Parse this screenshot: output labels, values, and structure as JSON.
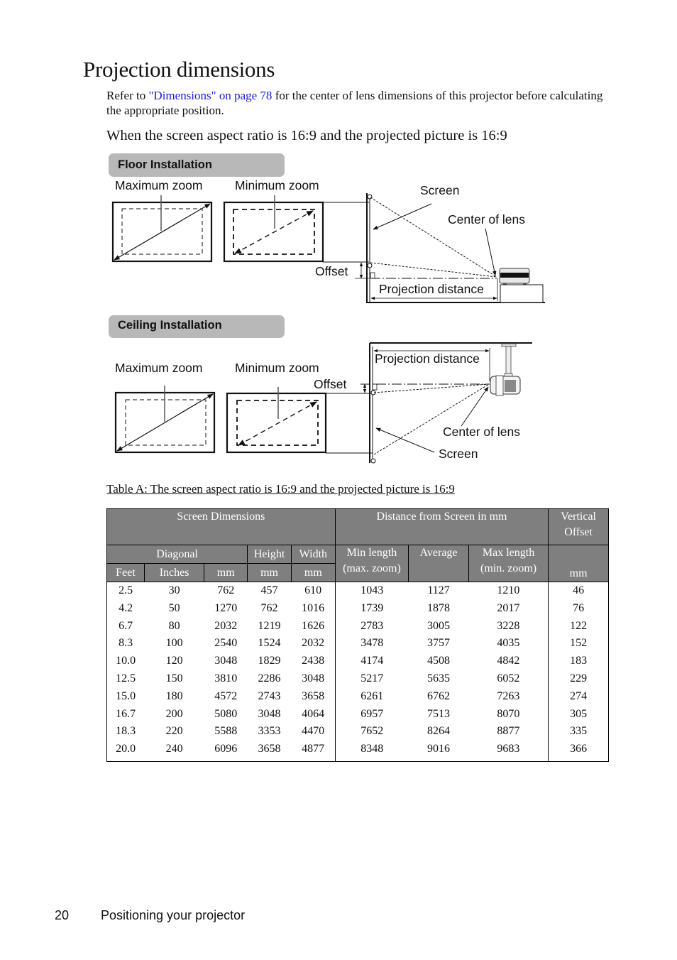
{
  "page": {
    "title": "Projection dimensions",
    "intro": {
      "prefix": "Refer to ",
      "link_text": "\"Dimensions\" on page 78",
      "suffix": " for the center of lens dimensions of this projector before calculating the appropriate position."
    },
    "subheading": "When the screen aspect ratio is 16:9 and the projected picture is 16:9"
  },
  "diagrams": {
    "floor": {
      "title": "Floor Installation",
      "labels": {
        "maximum_zoom": "Maximum zoom",
        "minimum_zoom": "Minimum zoom",
        "screen": "Screen",
        "center_of_lens": "Center of lens",
        "offset": "Offset",
        "projection_distance": "Projection distance"
      }
    },
    "ceiling": {
      "title": "Ceiling Installation",
      "labels": {
        "maximum_zoom": "Maximum zoom",
        "minimum_zoom": "Minimum zoom",
        "screen": "Screen",
        "center_of_lens": "Center of lens",
        "offset": "Offset",
        "projection_distance": "Projection distance"
      }
    }
  },
  "table": {
    "caption": "Table A: The screen aspect ratio is 16:9 and the projected picture is 16:9",
    "headers": {
      "screen_dimensions": "Screen Dimensions",
      "distance_from_screen": "Distance from Screen in mm",
      "vertical_offset": "Vertical Offset",
      "diagonal": "Diagonal",
      "height": "Height",
      "width": "Width",
      "min_length": "Min length (max. zoom)",
      "average": "Average",
      "max_length": "Max length (min. zoom)",
      "feet": "Feet",
      "inches": "Inches",
      "mm": "mm"
    },
    "columns": [
      "Feet",
      "Inches",
      "Diagonal mm",
      "Height mm",
      "Width mm",
      "Min length (max. zoom)",
      "Average",
      "Max length (min. zoom)",
      "Vertical Offset mm"
    ],
    "rows": [
      [
        "2.5",
        "30",
        "762",
        "457",
        "610",
        "1043",
        "1127",
        "1210",
        "46"
      ],
      [
        "4.2",
        "50",
        "1270",
        "762",
        "1016",
        "1739",
        "1878",
        "2017",
        "76"
      ],
      [
        "6.7",
        "80",
        "2032",
        "1219",
        "1626",
        "2783",
        "3005",
        "3228",
        "122"
      ],
      [
        "8.3",
        "100",
        "2540",
        "1524",
        "2032",
        "3478",
        "3757",
        "4035",
        "152"
      ],
      [
        "10.0",
        "120",
        "3048",
        "1829",
        "2438",
        "4174",
        "4508",
        "4842",
        "183"
      ],
      [
        "12.5",
        "150",
        "3810",
        "2286",
        "3048",
        "5217",
        "5635",
        "6052",
        "229"
      ],
      [
        "15.0",
        "180",
        "4572",
        "2743",
        "3658",
        "6261",
        "6762",
        "7263",
        "274"
      ],
      [
        "16.7",
        "200",
        "5080",
        "3048",
        "4064",
        "6957",
        "7513",
        "8070",
        "305"
      ],
      [
        "18.3",
        "220",
        "5588",
        "3353",
        "4470",
        "7652",
        "8264",
        "8877",
        "335"
      ],
      [
        "20.0",
        "240",
        "6096",
        "3658",
        "4877",
        "8348",
        "9016",
        "9683",
        "366"
      ]
    ]
  },
  "footer": {
    "page_number": "20",
    "section": "Positioning your projector"
  }
}
